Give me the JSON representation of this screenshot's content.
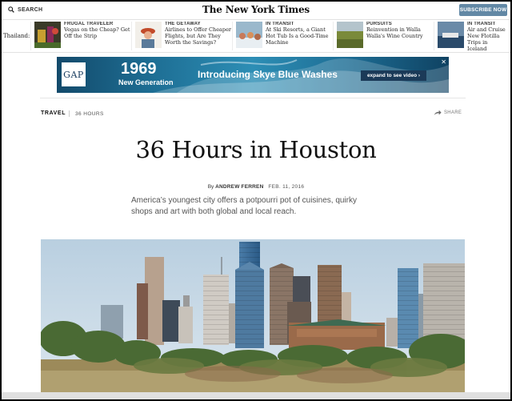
{
  "header": {
    "search_label": "SEARCH",
    "logo_text": "The New York Times",
    "subscribe_label": "SUBSCRIBE NOW"
  },
  "strip": {
    "lead_fragment": "Thailand:",
    "promos": [
      {
        "kicker": "FRUGAL TRAVELER",
        "headline": "Vegas on the Cheap? Get Off the Strip"
      },
      {
        "kicker": "THE GETAWAY",
        "headline": "Airlines to Offer Cheaper Flights, but Are They Worth the Savings?"
      },
      {
        "kicker": "IN TRANSIT",
        "headline": "At Ski Resorts, a Giant Hot Tub Is a Good-Time Machine"
      },
      {
        "kicker": "PURSUITS",
        "headline": "Reinvention in Walla Walla's Wine Country"
      },
      {
        "kicker": "IN TRANSIT",
        "headline": "Air and Cruise New Flotilla Trips in Iceland Excursion"
      }
    ]
  },
  "ad": {
    "brand": "GAP",
    "year": "1969",
    "subtitle": "New Generation",
    "headline": "Introducing Skye Blue Washes",
    "cta": "expand to see video ›",
    "close": "✕"
  },
  "article": {
    "section": "TRAVEL",
    "series": "36 HOURS",
    "share_label": "SHARE",
    "title": "36 Hours in Houston",
    "byline_prefix": "By",
    "author": "ANDREW FERREN",
    "date": "FEB. 11, 2016",
    "summary": "America’s youngest city offers a potpourri pot of cuisines, quirky shops and art with both global and local reach."
  },
  "icons": {
    "search": "search-icon",
    "share": "share-arrow-icon",
    "close": "close-icon"
  },
  "colors": {
    "subscribe_bg": "#6288a5",
    "ad_bg": "#1e6f95",
    "sky": "#c8d8e4"
  }
}
